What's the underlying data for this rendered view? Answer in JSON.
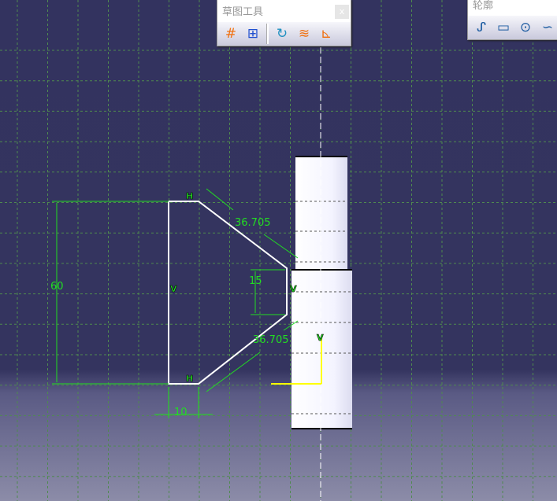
{
  "toolbars": {
    "sketch_tools": {
      "title": "草图工具",
      "close": "x",
      "icons": [
        "grid-icon",
        "snap-to-point-icon",
        "construction-element-icon",
        "geometric-constraints-icon",
        "dimensional-constraints-icon"
      ]
    },
    "profile": {
      "title": "轮廓",
      "icons": [
        "profile-icon",
        "rectangle-icon",
        "circle-icon",
        "spline-icon"
      ]
    }
  },
  "sketch": {
    "dimensions": {
      "height": "60",
      "top_chamfer": "36.705",
      "bottom_chamfer": "36.705",
      "inner_height": "15",
      "bottom_width": "10"
    },
    "constraints": {
      "horizontal": "H",
      "vertical": "V"
    }
  },
  "colors": {
    "background": "#33335f",
    "grid": "#4a8a4a",
    "profile": "#ffffff",
    "dimension": "#22dd22",
    "axis": "#ffff00"
  }
}
